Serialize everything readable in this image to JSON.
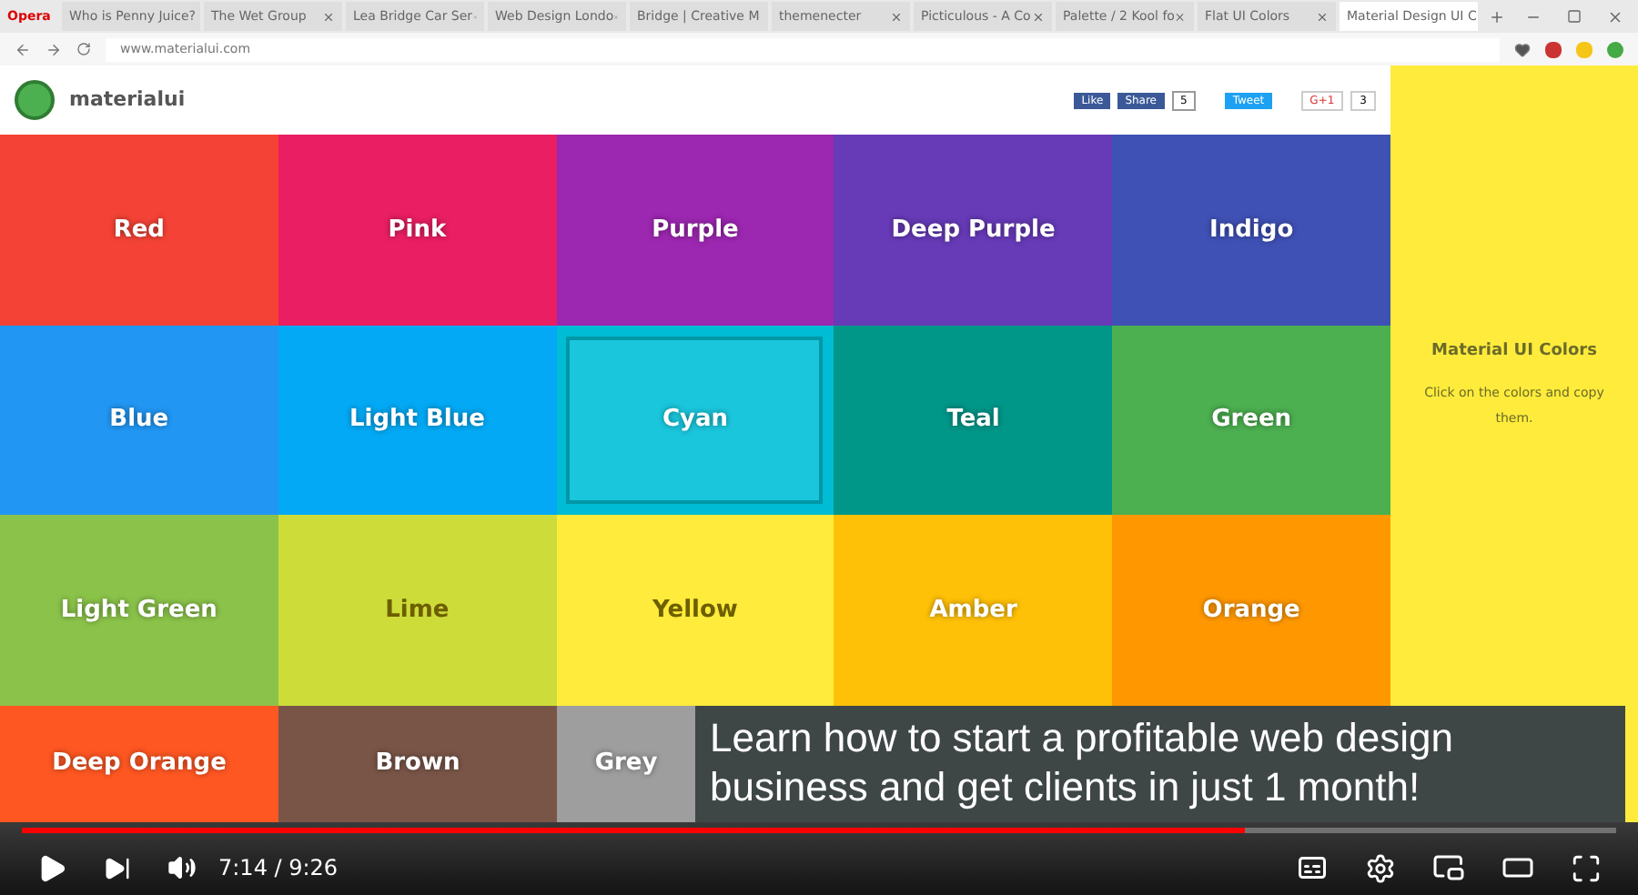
{
  "browser": {
    "menu": "Opera",
    "tabs": [
      {
        "label": "Who is Penny Juice?",
        "selected": false
      },
      {
        "label": "The Wet Group",
        "selected": false
      },
      {
        "label": "Lea Bridge Car Ser",
        "selected": false
      },
      {
        "label": "Web Design Londo",
        "selected": false
      },
      {
        "label": "Bridge | Creative M",
        "selected": false
      },
      {
        "label": "themenecter",
        "selected": false
      },
      {
        "label": "Picticulous - A Co",
        "selected": false
      },
      {
        "label": "Palette / 2 Kool fo",
        "selected": false
      },
      {
        "label": "Flat UI Colors",
        "selected": false
      },
      {
        "label": "Material Design UI C",
        "selected": true
      }
    ],
    "address": "www.materialui.com"
  },
  "site": {
    "logo": "materialui",
    "like": "Like",
    "share": "Share",
    "share_count": "5",
    "tweet": "Tweet",
    "gplus": "G+1",
    "gplus_count": "3"
  },
  "tiles": [
    {
      "name": "Red",
      "color": "#f44336",
      "selected": false
    },
    {
      "name": "Pink",
      "color": "#e91e63",
      "selected": false
    },
    {
      "name": "Purple",
      "color": "#9c27b0",
      "selected": false
    },
    {
      "name": "Deep Purple",
      "color": "#673ab7",
      "selected": false
    },
    {
      "name": "Indigo",
      "color": "#3f51b5",
      "selected": false
    },
    {
      "name": "Blue",
      "color": "#2196f3",
      "selected": false
    },
    {
      "name": "Light Blue",
      "color": "#03a9f4",
      "selected": false
    },
    {
      "name": "Cyan",
      "color": "#00bcd4",
      "selected": true
    },
    {
      "name": "Teal",
      "color": "#009688",
      "selected": false
    },
    {
      "name": "Green",
      "color": "#4caf50",
      "selected": false
    },
    {
      "name": "Light Green",
      "color": "#8bc34a",
      "selected": false
    },
    {
      "name": "Lime",
      "color": "#cddc39",
      "selected": false
    },
    {
      "name": "Yellow",
      "color": "#ffeb3b",
      "selected": false
    },
    {
      "name": "Amber",
      "color": "#ffc107",
      "selected": false
    },
    {
      "name": "Orange",
      "color": "#ff9800",
      "selected": false
    },
    {
      "name": "Deep Orange",
      "color": "#ff5722",
      "selected": false
    },
    {
      "name": "Brown",
      "color": "#795548",
      "selected": false
    },
    {
      "name": "Grey",
      "color": "#9e9e9e",
      "selected": false
    }
  ],
  "sidebar": {
    "title": "Material UI Colors",
    "text": "Click on the colors and copy them."
  },
  "caption": "Learn how to start a profitable web design business and get clients in just 1 month!",
  "player": {
    "time": "7:14 / 9:26",
    "level": 0.767
  }
}
